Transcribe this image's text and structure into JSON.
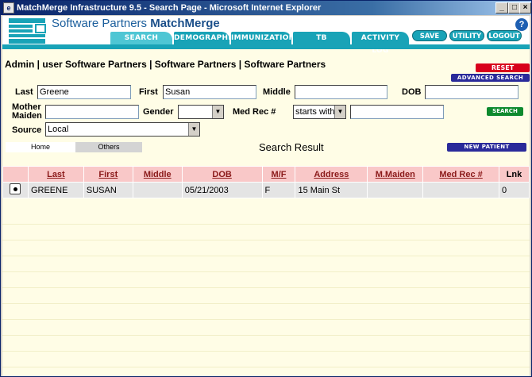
{
  "window": {
    "title": "MatchMerge Infrastructure 9.5 - Search Page - Microsoft Internet Explorer",
    "min": "_",
    "max": "□",
    "close": "×"
  },
  "header": {
    "brand_prefix": "Software Partners ",
    "brand_name": "MatchMerge",
    "help": "?"
  },
  "tabs": [
    {
      "label": "SEARCH"
    },
    {
      "label": "DEMOGRAPHICS"
    },
    {
      "label": "IMMUNIZATIONS"
    },
    {
      "label": "TB"
    },
    {
      "label": "ACTIVITY LOG"
    }
  ],
  "actions": {
    "save": "SAVE",
    "utility": "UTILITY",
    "logout": "LOGOUT"
  },
  "breadcrumb": "Admin | user Software Partners | Software Partners | Software Partners",
  "buttons": {
    "reset": "RESET",
    "advanced": "ADVANCED SEARCH",
    "search": "SEARCH",
    "new_patient": "NEW PATIENT"
  },
  "form": {
    "last_label": "Last",
    "last_value": "Greene",
    "first_label": "First",
    "first_value": "Susan",
    "middle_label": "Middle",
    "middle_value": "",
    "dob_label": "DOB",
    "dob_value": "",
    "mother_label_1": "Mother",
    "mother_label_2": "Maiden",
    "mother_value": "",
    "gender_label": "Gender",
    "gender_value": "",
    "medrec_label": "Med Rec #",
    "medrec_mode": "starts with",
    "medrec_value": "",
    "source_label": "Source",
    "source_value": "Local"
  },
  "subtabs": {
    "home": "Home",
    "others": "Others"
  },
  "result_title": "Search Result",
  "table": {
    "headers": [
      "Last",
      "First",
      "Middle",
      "DOB",
      "M/F",
      "Address",
      "M.Maiden",
      "Med Rec #",
      "Lnk"
    ],
    "rows": [
      [
        "GREENE",
        "SUSAN",
        "",
        "05/21/2003",
        "F",
        "15 Main St",
        "",
        "",
        "0"
      ]
    ]
  }
}
